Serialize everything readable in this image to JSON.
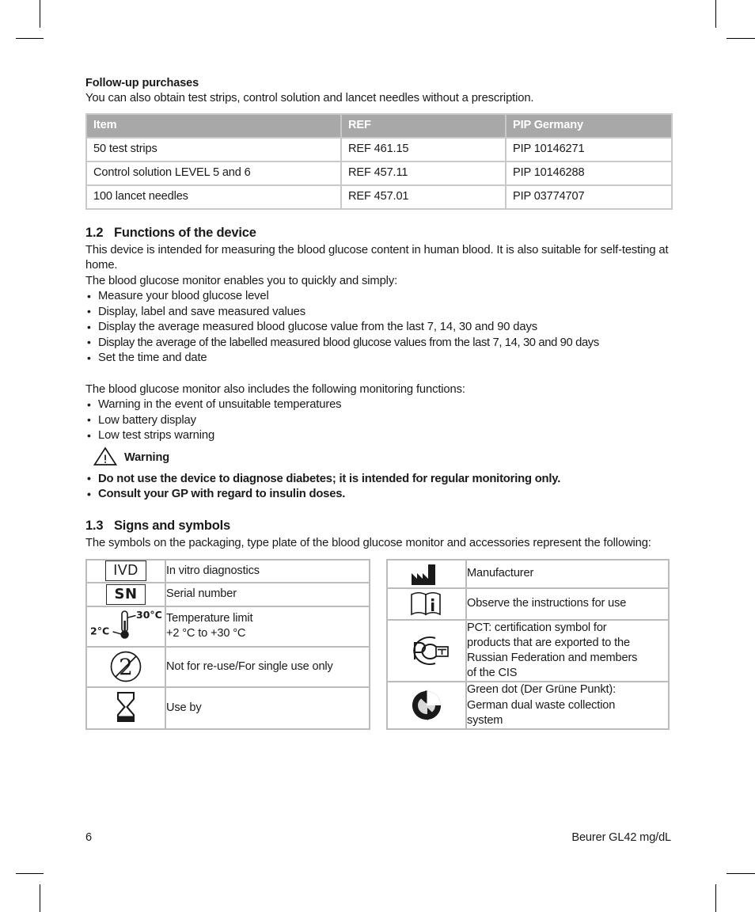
{
  "purchases": {
    "heading": "Follow-up purchases",
    "intro": "You can also obtain test strips, control solution and lancet needles without a prescription.",
    "columns": [
      "Item",
      "REF",
      "PIP Germany"
    ],
    "rows": [
      [
        "50 test strips",
        "REF 461.15",
        "PIP 10146271"
      ],
      [
        "Control solution LEVEL 5 and 6",
        "REF 457.11",
        "PIP 10146288"
      ],
      [
        "100 lancet needles",
        "REF 457.01",
        "PIP 03774707"
      ]
    ]
  },
  "functions": {
    "number": "1.2",
    "title": "Functions of the device",
    "para1": "This device is intended for measuring the blood glucose content in human blood. It is also suitable for self-testing at home.",
    "para2": "The blood glucose monitor enables you to quickly and simply:",
    "bullets": [
      "Measure your blood glucose level",
      "Display, label and save measured values",
      "Display the average measured blood glucose value from the last 7, 14, 30 and 90 days",
      "Display the average of the labelled measured blood glucose values from the last 7, 14, 30 and 90 days",
      "Set the time and date"
    ],
    "para3": "The blood glucose monitor also includes the following monitoring functions:",
    "monitoring_bullets": [
      "Warning in the event of unsuitable temperatures",
      "Low battery display",
      "Low test strips warning"
    ],
    "warning_label": "Warning",
    "warning_bullets": [
      "Do not use the device to diagnose diabetes; it is intended for regular monitoring only.",
      "Consult your GP with regard to insulin doses."
    ]
  },
  "signs": {
    "number": "1.3",
    "title": "Signs and symbols",
    "intro": "The symbols on the packaging, type plate of the blood glucose monitor and accessories represent the following:",
    "left_rows": [
      {
        "icon": "ivd-icon",
        "icon_text": "IVD",
        "label": "In vitro diagnostics"
      },
      {
        "icon": "sn-icon",
        "icon_text": "SN",
        "label": "Serial number"
      },
      {
        "icon": "temperature-limit-icon",
        "icon_low": "2°C",
        "icon_high": "30°C",
        "label_line1": "Temperature limit",
        "label_line2": "+2 °C to +30 °C"
      },
      {
        "icon": "no-reuse-icon",
        "label": "Not for re-use/For single use only"
      },
      {
        "icon": "use-by-hourglass-icon",
        "label": "Use by"
      }
    ],
    "right_rows": [
      {
        "icon": "manufacturer-factory-icon",
        "label": "Manufacturer"
      },
      {
        "icon": "instructions-for-use-icon",
        "label": "Observe the instructions for use"
      },
      {
        "icon": "pct-certification-icon",
        "label_lines": [
          "PCT: certification symbol for",
          "products that are exported to the",
          "Russian Federation and members",
          "of the CIS"
        ]
      },
      {
        "icon": "green-dot-recycling-icon",
        "label_lines": [
          "Green dot (Der Grüne Punkt):",
          "German dual waste collection",
          "system"
        ]
      }
    ]
  },
  "footer": {
    "page_number": "6",
    "product": "Beurer GL42 mg/dL"
  }
}
